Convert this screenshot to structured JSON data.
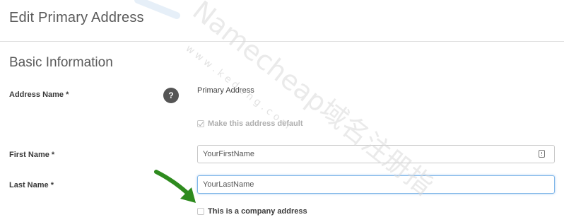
{
  "page": {
    "title": "Edit Primary Address"
  },
  "section": {
    "title": "Basic Information"
  },
  "form": {
    "address_name": {
      "label": "Address Name *",
      "help_icon": "question-mark-icon",
      "help_glyph": "?",
      "value": "Primary Address"
    },
    "make_default": {
      "label": "Make this address default",
      "checked": true,
      "disabled": true
    },
    "first_name": {
      "label": "First Name *",
      "value": "YourFirstName",
      "icon": "contact-card-icon"
    },
    "last_name": {
      "label": "Last Name *",
      "value": "YourLastName",
      "focused": true
    },
    "company_address": {
      "label": "This is a company address",
      "checked": false
    }
  },
  "overlay": {
    "watermark_text": "Namecheap域名注册指",
    "watermark_url_text": "w w w . k e d e n g . c o m",
    "arrow_color": "#2e8b1e",
    "arrow_icon": "green-pointer-arrow-icon"
  },
  "colors": {
    "focus_border": "#7fb6e8",
    "label": "#3a3a3a",
    "disabled_text": "#b0b0b0"
  }
}
